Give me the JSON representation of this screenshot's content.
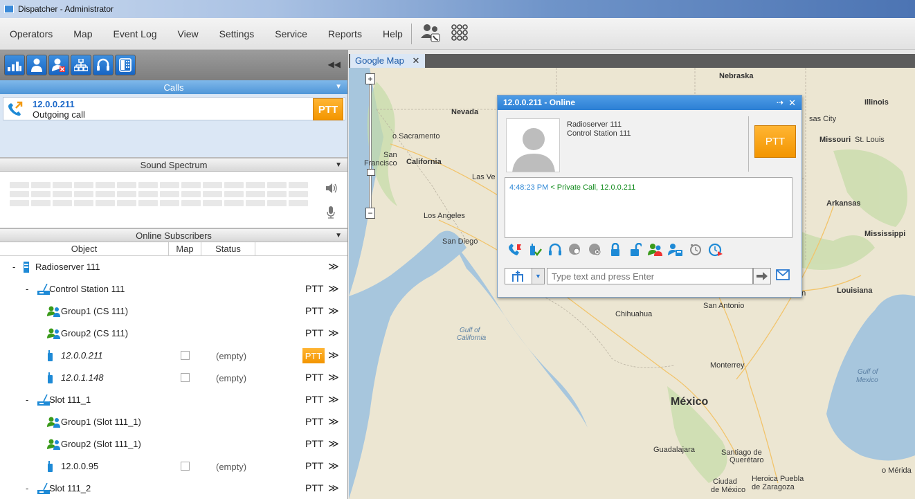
{
  "window": {
    "title": "Dispatcher - Administrator"
  },
  "menu": {
    "items": [
      "Operators",
      "Map",
      "Event Log",
      "View",
      "Settings",
      "Service",
      "Reports",
      "Help"
    ]
  },
  "left": {
    "calls_header": "Calls",
    "call": {
      "number": "12.0.0.211",
      "description": "Outgoing call",
      "ptt": "PTT"
    },
    "spectrum_header": "Sound Spectrum",
    "subscribers_header": "Online Subscribers",
    "columns": {
      "object": "Object",
      "map": "Map",
      "status": "Status"
    },
    "tree": [
      {
        "label": "Radioserver 111",
        "level": 0,
        "kind": "server",
        "minus": "-",
        "ptt": "",
        "more": "≫"
      },
      {
        "label": "Control Station 111",
        "level": 1,
        "kind": "station",
        "minus": "-",
        "ptt": "PTT",
        "more": "≫"
      },
      {
        "label": "Group1 (CS 111)",
        "level": 2,
        "kind": "group",
        "ptt": "PTT",
        "more": "≫"
      },
      {
        "label": "Group2 (CS 111)",
        "level": 2,
        "kind": "group",
        "ptt": "PTT",
        "more": "≫"
      },
      {
        "label": "12.0.0.211",
        "level": 2,
        "kind": "radio",
        "italic": true,
        "status": "(empty)",
        "ptt": "PTT",
        "active": true,
        "more": "≫"
      },
      {
        "label": "12.0.1.148",
        "level": 2,
        "kind": "radio",
        "italic": true,
        "status": "(empty)",
        "ptt": "PTT",
        "more": "≫"
      },
      {
        "label": "Slot 111_1",
        "level": 1,
        "kind": "station",
        "minus": "-",
        "ptt": "PTT",
        "more": "≫"
      },
      {
        "label": "Group1 (Slot 111_1)",
        "level": 2,
        "kind": "group",
        "ptt": "PTT",
        "more": "≫"
      },
      {
        "label": "Group2 (Slot 111_1)",
        "level": 2,
        "kind": "group",
        "ptt": "PTT",
        "more": "≫"
      },
      {
        "label": "12.0.0.95",
        "level": 2,
        "kind": "radio",
        "status": "(empty)",
        "ptt": "PTT",
        "more": "≫"
      },
      {
        "label": "Slot 111_2",
        "level": 1,
        "kind": "station",
        "minus": "-",
        "ptt": "PTT",
        "more": "≫"
      }
    ]
  },
  "map": {
    "tab_label": "Google Map",
    "tab_close": "✕",
    "labels": [
      {
        "text": "Nebraska",
        "cls": "bold"
      },
      {
        "text": "Illinois",
        "cls": "bold"
      },
      {
        "text": "Nevada",
        "cls": "bold"
      },
      {
        "text": "sas City",
        "cls": ""
      },
      {
        "text": "Missouri",
        "cls": "bold"
      },
      {
        "text": "St. Louis",
        "cls": ""
      },
      {
        "text": "o Sacramento",
        "cls": ""
      },
      {
        "text": "San",
        "cls": ""
      },
      {
        "text": "Francisco",
        "cls": ""
      },
      {
        "text": "California",
        "cls": "bold"
      },
      {
        "text": "Las Ve",
        "cls": ""
      },
      {
        "text": "Arkansas",
        "cls": "bold"
      },
      {
        "text": "Los Angeles",
        "cls": ""
      },
      {
        "text": "San Diego",
        "cls": ""
      },
      {
        "text": "Mississippi",
        "cls": "bold"
      },
      {
        "text": "ton",
        "cls": ""
      },
      {
        "text": "Louisiana",
        "cls": "bold"
      },
      {
        "text": "San Antonio",
        "cls": ""
      },
      {
        "text": "Chihuahua",
        "cls": ""
      },
      {
        "text": "Gulf of",
        "cls": "italic"
      },
      {
        "text": "California",
        "cls": "italic"
      },
      {
        "text": "Monterrey",
        "cls": ""
      },
      {
        "text": "Gulf of",
        "cls": "italic"
      },
      {
        "text": "Mexico",
        "cls": "italic"
      },
      {
        "text": "México",
        "cls": "big"
      },
      {
        "text": "Guadalajara",
        "cls": ""
      },
      {
        "text": "Santiago de",
        "cls": ""
      },
      {
        "text": "Querétaro",
        "cls": ""
      },
      {
        "text": "o Mérida",
        "cls": ""
      },
      {
        "text": "Ciudad",
        "cls": ""
      },
      {
        "text": "de México",
        "cls": ""
      },
      {
        "text": "Heroica Puebla",
        "cls": ""
      },
      {
        "text": "de Zaragoza",
        "cls": ""
      }
    ]
  },
  "popup": {
    "title": "12.0.0.211 - Online",
    "server": "Radioserver  111",
    "station": "Control Station  111",
    "ptt": "PTT",
    "message_time": "4:48:23 PM",
    "message_text": " < Private Call, 12.0.0.211",
    "placeholder": "Type text and press Enter"
  }
}
